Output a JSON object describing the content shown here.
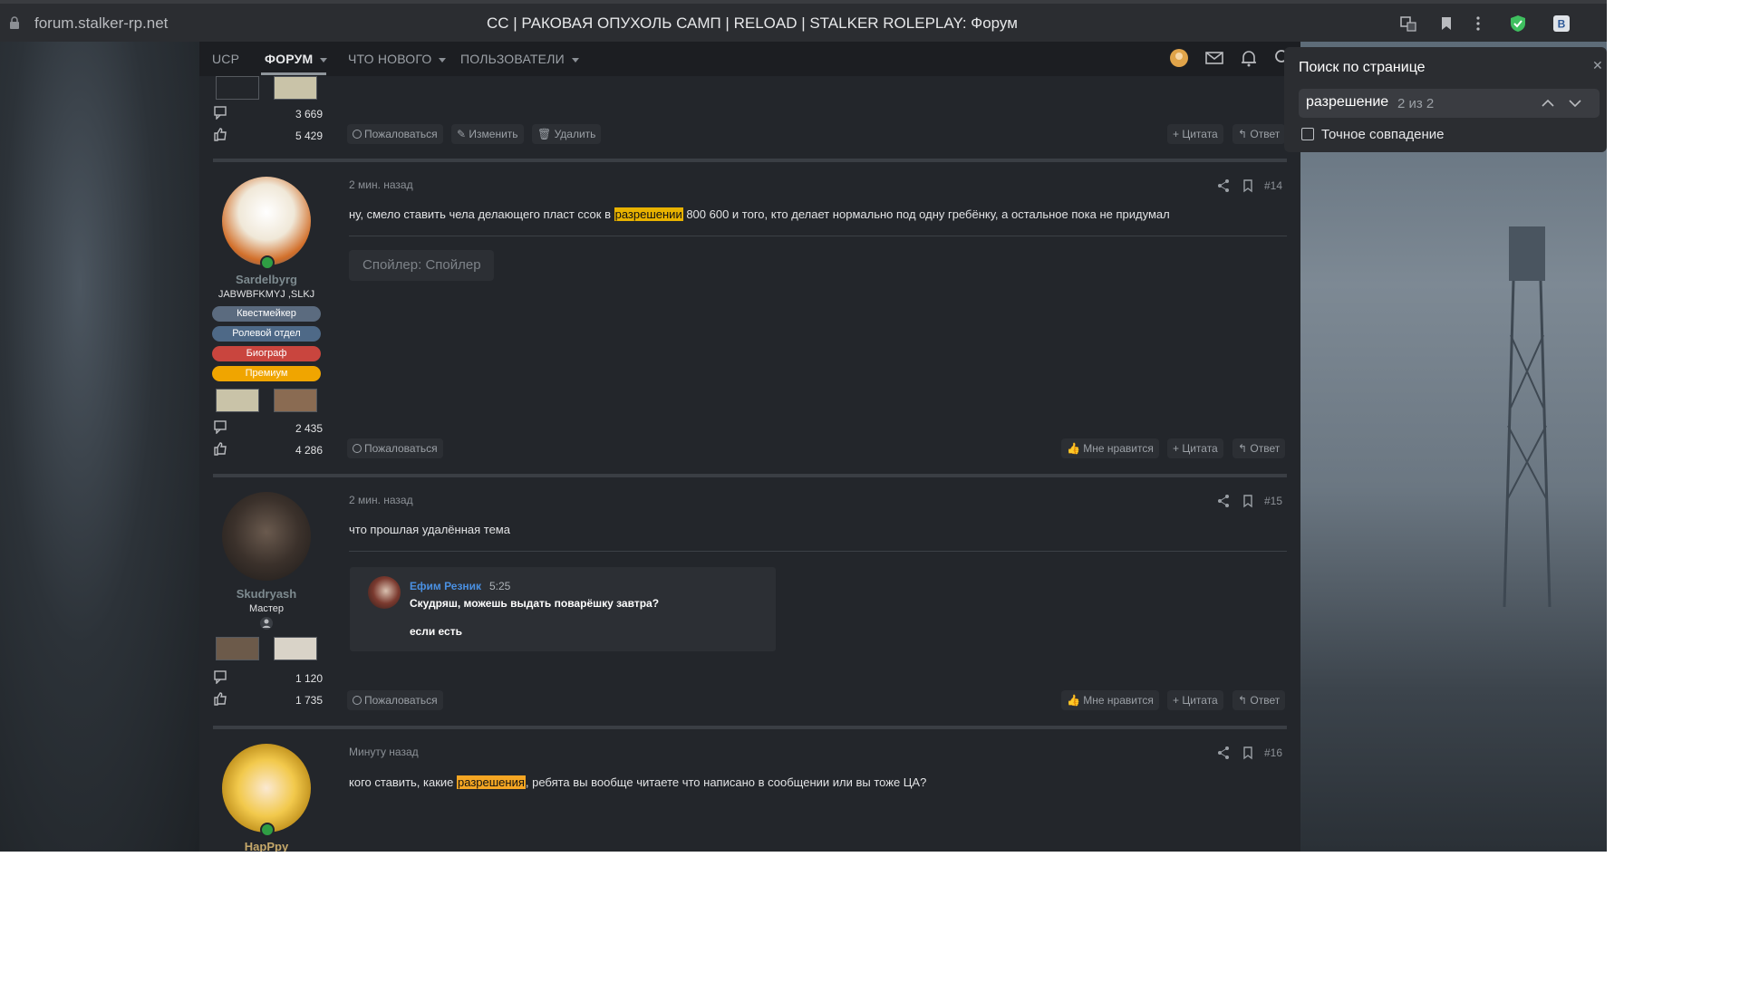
{
  "browser": {
    "url": "forum.stalker-rp.net",
    "title": "СС | РАКОВАЯ ОПУХОЛЬ САМП | RELOAD | STALKER ROLEPLAY: Форум"
  },
  "nav": {
    "items": [
      {
        "label": "UCP"
      },
      {
        "label": "ФОРУМ"
      },
      {
        "label": "ЧТО НОВОГО"
      },
      {
        "label": "ПОЛЬЗОВАТЕЛИ"
      }
    ]
  },
  "find": {
    "title": "Поиск по странице",
    "value": "разрешение",
    "count": "2 из 2",
    "exact_label": "Точное совпадение"
  },
  "top_post": {
    "messages": "3 669",
    "likes": "5 429",
    "actions": {
      "report": "Пожаловаться",
      "edit": "Изменить",
      "delete": "Удалить",
      "quote": "Цитата",
      "reply": "Ответ"
    }
  },
  "posts": [
    {
      "time": "2 мин. назад",
      "number": "#14",
      "text_before": "ну, смело ставить чела делающего пласт ссок в ",
      "highlight": "разрешении",
      "text_after": " 800 600 и того, кто делает нормально под одну гребёнку, а остальное пока не придумал",
      "spoiler": "Спойлер: Спойлер",
      "user": {
        "name": "Sardelbyrg",
        "title": "JABWBFKMYJ ,SLKJ",
        "badges": [
          "Квестмейкер",
          "Ролевой отдел",
          "Биограф",
          "Премиум"
        ],
        "messages": "2 435",
        "likes": "4 286"
      },
      "actions": {
        "report": "Пожаловаться",
        "like": "Мне нравится",
        "quote": "Цитата",
        "reply": "Ответ"
      }
    },
    {
      "time": "2 мин. назад",
      "number": "#15",
      "text": "что прошлая удалённая тема",
      "quote": {
        "author": "Ефим Резник",
        "time": "5:25",
        "line1": "Скудряш, можешь выдать поварёшку завтра?",
        "line2": "если есть"
      },
      "user": {
        "name": "Skudryash",
        "title": "Мастер",
        "messages": "1 120",
        "likes": "1 735"
      },
      "actions": {
        "report": "Пожаловаться",
        "like": "Мне нравится",
        "quote": "Цитата",
        "reply": "Ответ"
      }
    },
    {
      "time": "Минуту назад",
      "number": "#16",
      "text_before": "кого ставить, какие ",
      "highlight": "разрешения",
      "text_after": ", ребята вы вообще читаете что написано в сообщении или вы тоже ЦА?",
      "user": {
        "name": "HapPpy"
      }
    }
  ],
  "colors": {
    "find_highlight": "#f5a623",
    "active_highlight": "#e8b200",
    "quote_author": "#4a90e2",
    "badge_quest": "#5b6b7f",
    "badge_role": "#4e6987",
    "badge_bio": "#d9534f",
    "badge_premium": "#f0a500"
  }
}
